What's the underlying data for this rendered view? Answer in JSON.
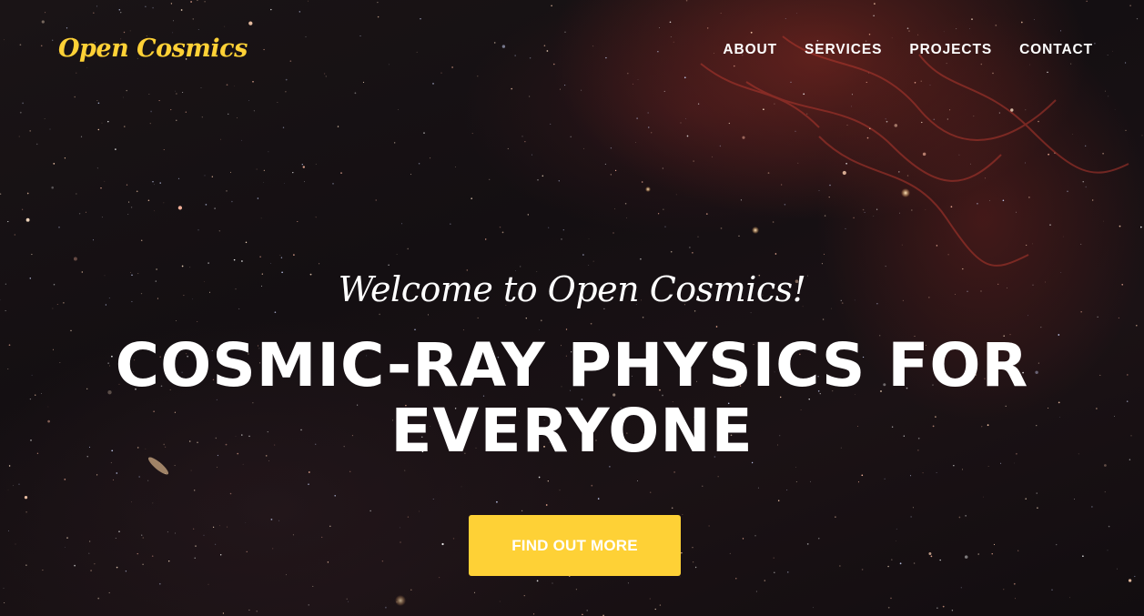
{
  "brand": {
    "name": "Open Cosmics"
  },
  "nav": {
    "items": [
      {
        "label": "ABOUT"
      },
      {
        "label": "SERVICES"
      },
      {
        "label": "PROJECTS"
      },
      {
        "label": "CONTACT"
      }
    ]
  },
  "hero": {
    "welcome": "Welcome to Open Cosmics!",
    "headline_line1": "COSMIC-RAY PHYSICS FOR",
    "headline_line2": "EVERYONE",
    "cta_label": "FIND OUT MORE"
  },
  "colors": {
    "accent": "#fed136",
    "nav_text": "#ffffff",
    "headline_text": "#ffffff",
    "cta_text": "#ffffff",
    "background": "#141012"
  }
}
